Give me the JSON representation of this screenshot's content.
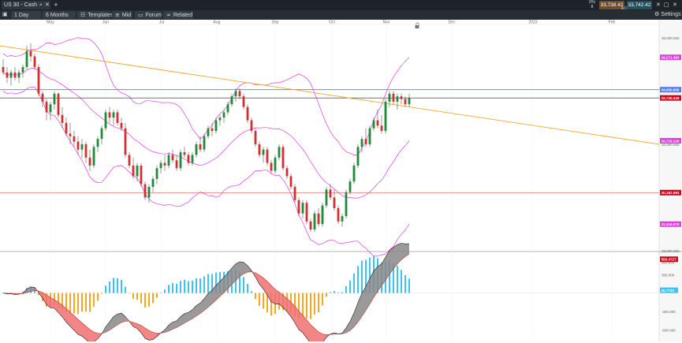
{
  "window": {
    "tab_title": "US 30 - Cash",
    "settings_label": "Settings",
    "bid_price": "33,738.42",
    "ask_price": "33,742.42",
    "change_pct": "0%",
    "change_count": "8",
    "spread": "4.00"
  },
  "toolbar": {
    "timeframe_label": "1 Day",
    "range_label": "6 Months",
    "templates_label": "Templates",
    "mid_label": "Mid",
    "forum_label": "Forum",
    "related_label": "Related"
  },
  "icons": {
    "search": "search-icon",
    "close": "close-icon",
    "add_tab": "plus-icon",
    "settings": "gear-icon",
    "lock": "lock-icon"
  },
  "colors": {
    "bull": "#1f8a3a",
    "bear": "#d32f2f",
    "bollinger": "#e23ce8",
    "trendline": "#f5a623",
    "resistance": "#4f7fe6",
    "support": "#e05a5a",
    "price_level": "#222222",
    "macd_pos": "#3cc4ee",
    "macd_neg": "#f5a623",
    "macd_fill_up": "#888888",
    "macd_fill_down": "#f07070",
    "price_tag": "#d0021b",
    "upper_band_tag": "#e23ce8",
    "signal_tag": "#3cc4ee"
  },
  "chart_data": [
    {
      "type": "candlestick",
      "months": [
        "May",
        "Jun",
        "Jul",
        "Aug",
        "Sep",
        "Oct",
        "Nov",
        "Dec",
        "2023",
        "Feb"
      ],
      "y_ticks": [
        "36,000.000",
        "32,000.000",
        "28,000.000"
      ],
      "ylim": [
        28000,
        36500
      ],
      "price_tags": {
        "upper_band": "34,271.463",
        "resistance": "34,050.830",
        "current": "33,740.426",
        "mid_band": "32,719.129",
        "lower_band": "31,344.878",
        "support": "30,182.993"
      },
      "levels": {
        "resistance": 34050,
        "current": 33740,
        "support": 30183
      },
      "candles": [
        [
          34900,
          35200,
          34600,
          34700
        ],
        [
          34700,
          34900,
          34300,
          34500
        ],
        [
          34500,
          34800,
          34200,
          34700
        ],
        [
          34700,
          34900,
          34400,
          34500
        ],
        [
          34500,
          34800,
          34300,
          34700
        ],
        [
          34700,
          35000,
          34500,
          34900
        ],
        [
          34900,
          35700,
          34800,
          35500
        ],
        [
          35500,
          35800,
          35100,
          35300
        ],
        [
          35300,
          35400,
          34800,
          34900
        ],
        [
          34900,
          35000,
          33800,
          33900
        ],
        [
          33900,
          34000,
          33400,
          33600
        ],
        [
          33600,
          33700,
          32900,
          33200
        ],
        [
          33200,
          33600,
          32900,
          33500
        ],
        [
          33500,
          34000,
          33300,
          33900
        ],
        [
          33900,
          33950,
          33000,
          33100
        ],
        [
          33100,
          33400,
          32600,
          32800
        ],
        [
          32800,
          33000,
          32300,
          32400
        ],
        [
          32400,
          32800,
          32000,
          32300
        ],
        [
          32300,
          32500,
          31900,
          32100
        ],
        [
          32100,
          32300,
          31600,
          31800
        ],
        [
          31800,
          32200,
          31500,
          32000
        ],
        [
          32000,
          32100,
          31300,
          31500
        ],
        [
          31500,
          31800,
          31000,
          31200
        ],
        [
          31200,
          32000,
          31100,
          31900
        ],
        [
          31900,
          32300,
          31700,
          32200
        ],
        [
          32200,
          32700,
          32000,
          32600
        ],
        [
          32600,
          33300,
          32500,
          33200
        ],
        [
          33200,
          33400,
          32800,
          33000
        ],
        [
          33000,
          33300,
          32700,
          33200
        ],
        [
          33200,
          33300,
          32700,
          32800
        ],
        [
          32800,
          33000,
          32500,
          32600
        ],
        [
          32600,
          32800,
          31500,
          31600
        ],
        [
          31600,
          31700,
          31100,
          31200
        ],
        [
          31200,
          31500,
          30700,
          30800
        ],
        [
          30800,
          31300,
          30600,
          31200
        ],
        [
          31200,
          31300,
          30400,
          30500
        ],
        [
          30500,
          30600,
          29900,
          30000
        ],
        [
          30000,
          30500,
          29800,
          30400
        ],
        [
          30400,
          30800,
          30200,
          30700
        ],
        [
          30700,
          31200,
          30500,
          31100
        ],
        [
          31100,
          31400,
          30900,
          31300
        ],
        [
          31300,
          31600,
          31000,
          31200
        ],
        [
          31200,
          31700,
          31100,
          31600
        ],
        [
          31600,
          31800,
          31300,
          31400
        ],
        [
          31400,
          31600,
          31000,
          31100
        ],
        [
          31100,
          31800,
          31000,
          31700
        ],
        [
          31700,
          31900,
          31500,
          31600
        ],
        [
          31600,
          31700,
          31200,
          31300
        ],
        [
          31300,
          31700,
          31200,
          31600
        ],
        [
          31600,
          32100,
          31500,
          32000
        ],
        [
          32000,
          32300,
          31700,
          31800
        ],
        [
          31800,
          32400,
          31700,
          32300
        ],
        [
          32300,
          32700,
          32200,
          32600
        ],
        [
          32600,
          32800,
          32300,
          32500
        ],
        [
          32500,
          33000,
          32400,
          32900
        ],
        [
          32900,
          33100,
          32700,
          33000
        ],
        [
          33000,
          33300,
          32800,
          33200
        ],
        [
          33200,
          33600,
          33100,
          33500
        ],
        [
          33500,
          33900,
          33400,
          33800
        ],
        [
          33800,
          34100,
          33600,
          34000
        ],
        [
          34000,
          34100,
          33700,
          33800
        ],
        [
          33800,
          33900,
          33300,
          33400
        ],
        [
          33400,
          33500,
          32800,
          32900
        ],
        [
          32900,
          33000,
          32400,
          32500
        ],
        [
          32500,
          32600,
          31900,
          32000
        ],
        [
          32000,
          32100,
          31500,
          31600
        ],
        [
          31600,
          31900,
          31300,
          31800
        ],
        [
          31800,
          31900,
          31200,
          31300
        ],
        [
          31300,
          31400,
          30900,
          31000
        ],
        [
          31000,
          31600,
          30900,
          31500
        ],
        [
          31500,
          32000,
          31400,
          31900
        ],
        [
          31900,
          32000,
          31000,
          31100
        ],
        [
          31100,
          31200,
          30700,
          30800
        ],
        [
          30800,
          30900,
          30300,
          30400
        ],
        [
          30400,
          30500,
          29800,
          29900
        ],
        [
          29900,
          30000,
          29300,
          29400
        ],
        [
          29400,
          29900,
          29200,
          29800
        ],
        [
          29800,
          29900,
          29000,
          29100
        ],
        [
          29100,
          29200,
          28700,
          28800
        ],
        [
          28800,
          29500,
          28700,
          29400
        ],
        [
          29400,
          29600,
          28900,
          29000
        ],
        [
          29000,
          29800,
          28900,
          29700
        ],
        [
          29700,
          30400,
          29600,
          30300
        ],
        [
          30300,
          30500,
          29900,
          30000
        ],
        [
          30000,
          30300,
          29500,
          29600
        ],
        [
          29600,
          29700,
          29000,
          29100
        ],
        [
          29100,
          29400,
          28900,
          29300
        ],
        [
          29300,
          30300,
          29200,
          30200
        ],
        [
          30200,
          30700,
          30100,
          30600
        ],
        [
          30600,
          31300,
          30500,
          31200
        ],
        [
          31200,
          32000,
          31100,
          31900
        ],
        [
          31900,
          32300,
          31700,
          32200
        ],
        [
          32200,
          32600,
          31900,
          32000
        ],
        [
          32000,
          32700,
          31900,
          32600
        ],
        [
          32600,
          33000,
          32500,
          32900
        ],
        [
          32900,
          33300,
          32600,
          32700
        ],
        [
          32700,
          33100,
          32400,
          32500
        ],
        [
          32500,
          33700,
          32400,
          33600
        ],
        [
          33600,
          34000,
          33400,
          33900
        ],
        [
          33900,
          34000,
          33500,
          33600
        ],
        [
          33600,
          33900,
          33300,
          33800
        ],
        [
          33800,
          33900,
          33500,
          33700
        ],
        [
          33700,
          33800,
          33400,
          33500
        ],
        [
          33500,
          33900,
          33400,
          33740
        ]
      ]
    },
    {
      "type": "histogram",
      "y_ticks": [
        "500.000",
        "300.000",
        "-300.000",
        "-600.000"
      ],
      "ylim": [
        -750,
        650
      ],
      "value_tags": {
        "macd": "550.4727",
        "signal": "45.7742"
      }
    }
  ]
}
